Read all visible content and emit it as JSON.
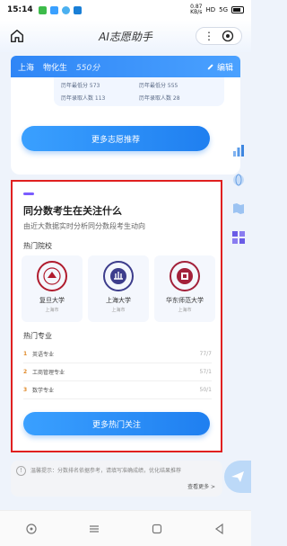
{
  "status_bar": {
    "time": "15:14",
    "net_speed": "0.87\nKB/s",
    "network": "HD",
    "signal": "5G"
  },
  "header": {
    "title": "AI志愿助手"
  },
  "user": {
    "region": "上海",
    "subjects": "物化生",
    "score": "550分",
    "edit_label": "编辑"
  },
  "top_stats": [
    "历年最低分 573",
    "历年最低分 555",
    "历年录取人数 113",
    "历年录取人数 28"
  ],
  "more_volunteer_button": "更多志愿推荐",
  "hot_card": {
    "title": "同分数考生在关注什么",
    "subtitle": "由近大数据实时分析同分数段考生动向",
    "schools_label": "热门院校",
    "majors_label": "热门专业",
    "schools": [
      {
        "name": "复旦大学",
        "location": "上海市",
        "color": "#b01c2e"
      },
      {
        "name": "上海大学",
        "location": "上海市",
        "color": "#3d3d8c"
      },
      {
        "name": "华东师范大学",
        "location": "上海市",
        "color": "#a3213a"
      }
    ],
    "majors": [
      {
        "rank": "1",
        "name": "英语专业",
        "value": "77/7"
      },
      {
        "rank": "2",
        "name": "工商管理专业",
        "value": "57/1"
      },
      {
        "rank": "3",
        "name": "数学专业",
        "value": "50/1"
      }
    ],
    "button": "更多热门关注"
  },
  "tip": {
    "text": "温馨提示：分数排名依据参考，请填写准确成绩，优化结果推荐",
    "more": "查看更多 >"
  },
  "colors": {
    "accent": "#2f86f6",
    "highlight_border": "#e02020"
  }
}
